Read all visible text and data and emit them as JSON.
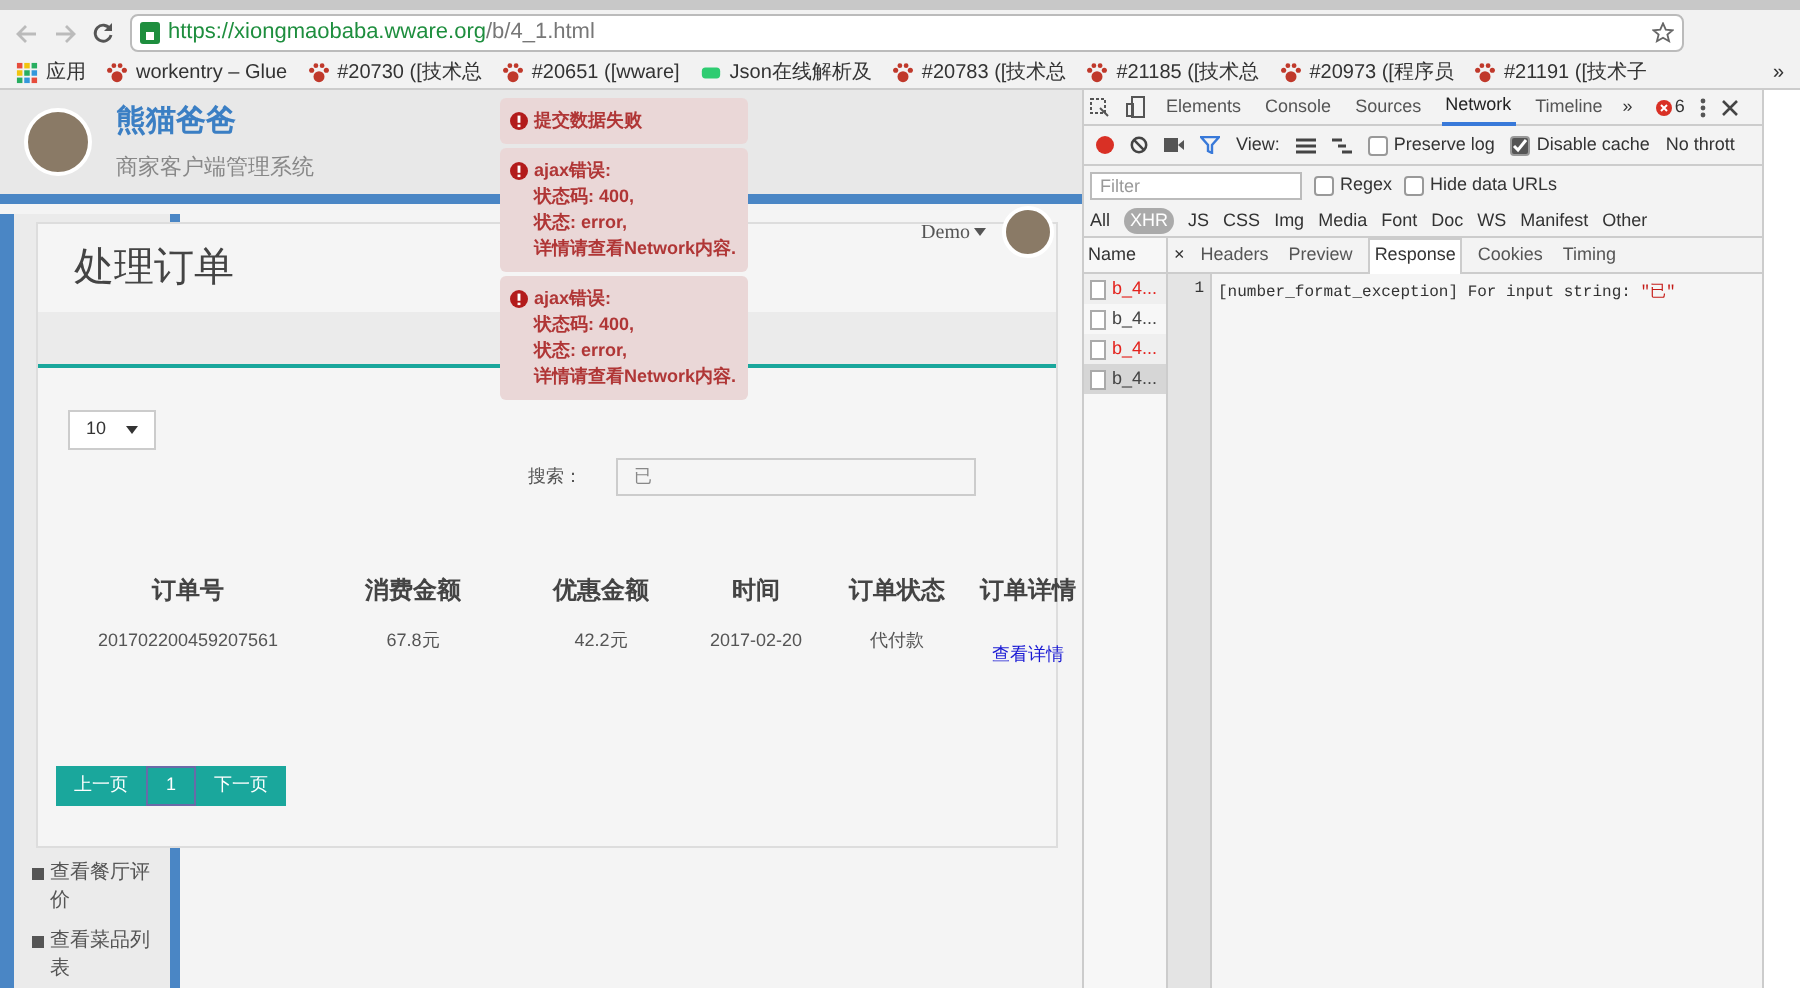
{
  "browser": {
    "url_host": "https://xiongmaobaba.wware.org",
    "url_path": "/b/4_1.html",
    "bookmarks": [
      {
        "label": "应用",
        "kind": "apps"
      },
      {
        "label": "workentry – Glue",
        "kind": "paw"
      },
      {
        "label": "#20730 ([技术总",
        "kind": "paw"
      },
      {
        "label": "#20651 ([wware]",
        "kind": "paw"
      },
      {
        "label": "Json在线解析及",
        "kind": "json"
      },
      {
        "label": "#20783 ([技术总",
        "kind": "paw"
      },
      {
        "label": "#21185 ([技术总",
        "kind": "paw"
      },
      {
        "label": "#20973 ([程序员",
        "kind": "paw"
      },
      {
        "label": "#21191 ([技术子",
        "kind": "paw"
      }
    ],
    "more": "»"
  },
  "header": {
    "title": "熊猫爸爸",
    "subtitle": "商家客户端管理系统"
  },
  "user": {
    "name": "Demo"
  },
  "sidebar": {
    "items": [
      "查看餐厅评价",
      "查看菜品列表"
    ]
  },
  "panel": {
    "title": "处理订单",
    "page_size": "10",
    "search_label": "搜索：",
    "search_value": "已",
    "columns": [
      "订单号",
      "消费金额",
      "优惠金额",
      "时间",
      "订单状态",
      "订单详情"
    ],
    "rows": [
      {
        "cells": [
          "201702200459207561",
          "67.8元",
          "42.2元",
          "2017-02-20",
          "代付款"
        ],
        "link": "查看详情"
      }
    ],
    "pagination": [
      {
        "label": "上一页",
        "selected": false
      },
      {
        "label": "1",
        "selected": true
      },
      {
        "label": "下一页",
        "selected": false
      }
    ]
  },
  "toasts": [
    {
      "lines": [
        "提交数据失败"
      ]
    },
    {
      "lines": [
        "ajax错误:",
        "状态码: 400,",
        "状态: error,",
        "详情请查看Network内容."
      ]
    },
    {
      "lines": [
        "ajax错误:",
        "状态码: 400,",
        "状态: error,",
        "详情请查看Network内容."
      ]
    }
  ],
  "devtools": {
    "tabs": [
      {
        "label": "Elements",
        "selected": false
      },
      {
        "label": "Console",
        "selected": false
      },
      {
        "label": "Sources",
        "selected": false
      },
      {
        "label": "Network",
        "selected": true
      },
      {
        "label": "Timeline",
        "selected": false
      }
    ],
    "more": "»",
    "error_count": "6",
    "view_label": "View:",
    "options": [
      {
        "label": "Preserve log",
        "checked": false
      },
      {
        "label": "Disable cache",
        "checked": true
      }
    ],
    "throttle": "No thrott",
    "filter_placeholder": "Filter",
    "filter_options": [
      {
        "label": "Regex",
        "checked": false
      },
      {
        "label": "Hide data URLs",
        "checked": false
      }
    ],
    "types": [
      {
        "label": "All",
        "selected": false
      },
      {
        "label": "XHR",
        "selected": true
      },
      {
        "label": "JS",
        "selected": false
      },
      {
        "label": "CSS",
        "selected": false
      },
      {
        "label": "Img",
        "selected": false
      },
      {
        "label": "Media",
        "selected": false
      },
      {
        "label": "Font",
        "selected": false
      },
      {
        "label": "Doc",
        "selected": false
      },
      {
        "label": "WS",
        "selected": false
      },
      {
        "label": "Manifest",
        "selected": false
      },
      {
        "label": "Other",
        "selected": false
      }
    ],
    "name_header": "Name",
    "requests": [
      {
        "name": "b_4...",
        "error": true,
        "selected": false
      },
      {
        "name": "b_4...",
        "error": false,
        "selected": false
      },
      {
        "name": "b_4...",
        "error": true,
        "selected": false
      },
      {
        "name": "b_4...",
        "error": false,
        "selected": true
      }
    ],
    "close": "×",
    "detail_tabs": [
      {
        "label": "Headers",
        "selected": false
      },
      {
        "label": "Preview",
        "selected": false
      },
      {
        "label": "Response",
        "selected": true
      },
      {
        "label": "Cookies",
        "selected": false
      },
      {
        "label": "Timing",
        "selected": false
      }
    ],
    "response": [
      {
        "line": "1",
        "text": "[number_format_exception] For input string: ",
        "value": "\"已\""
      }
    ]
  }
}
